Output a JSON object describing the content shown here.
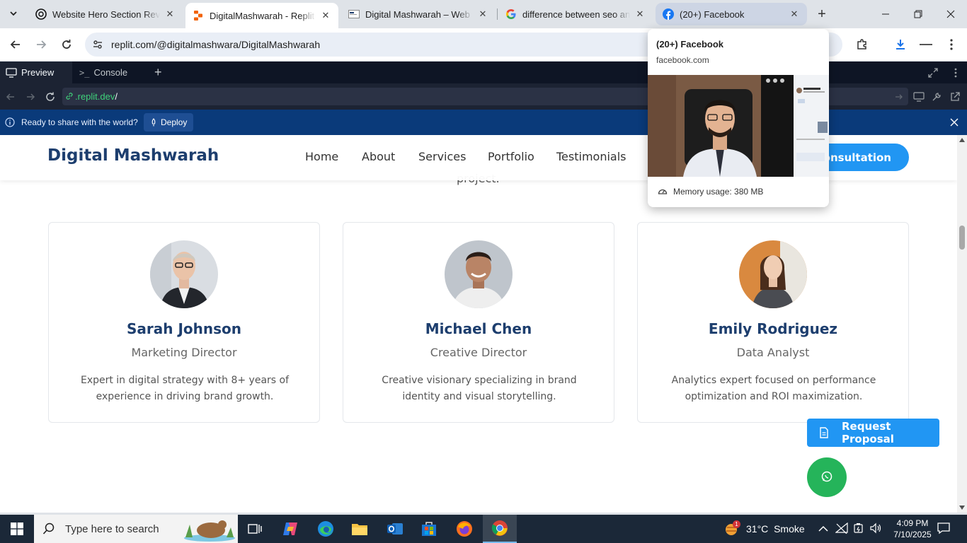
{
  "browser": {
    "tabs": [
      {
        "title": "Website Hero Section Review",
        "state": "inactive"
      },
      {
        "title": "DigitalMashwarah - Replit",
        "state": "active"
      },
      {
        "title": "Digital Mashwarah – Web Design",
        "state": "inactive"
      },
      {
        "title": "difference between seo and",
        "state": "inactive"
      },
      {
        "title": "(20+) Facebook",
        "state": "hovered"
      }
    ],
    "address": "replit.com/@digitalmashwara/DigitalMashwarah"
  },
  "hover_card": {
    "title": "(20+) Facebook",
    "domain": "facebook.com",
    "memory": "Memory usage: 380 MB"
  },
  "replit": {
    "tab_preview": "Preview",
    "tab_console": "Console",
    "url_host": ".replit.dev",
    "url_path": "/",
    "deploy_message": "Ready to share with the world?",
    "deploy_button": "Deploy"
  },
  "site": {
    "partial_text": "project.",
    "brand": "Digital Mashwarah",
    "nav": [
      "Home",
      "About",
      "Services",
      "Portfolio",
      "Testimonials"
    ],
    "cta_visible_text": "Consultation",
    "team": [
      {
        "name": "Sarah Johnson",
        "role": "Marketing Director",
        "description": "Expert in digital strategy with 8+ years of experience in driving brand growth."
      },
      {
        "name": "Michael Chen",
        "role": "Creative Director",
        "description": "Creative visionary specializing in brand identity and visual storytelling."
      },
      {
        "name": "Emily Rodriguez",
        "role": "Data Analyst",
        "description": "Analytics expert focused on performance optimization and ROI maximization."
      }
    ],
    "request_proposal": "Request Proposal"
  },
  "taskbar": {
    "search_placeholder": "Type here to search",
    "weather_temp": "31°C",
    "weather_desc": "Smoke",
    "time": "4:09 PM",
    "date": "7/10/2025",
    "weather_badge": "1"
  },
  "colors": {
    "brand_navy": "#1d3e6e",
    "accent_blue": "#2196f3",
    "chat_green": "#25b45a",
    "replit_bg": "#0e1525",
    "deploy_bar": "#0a3a7a"
  }
}
